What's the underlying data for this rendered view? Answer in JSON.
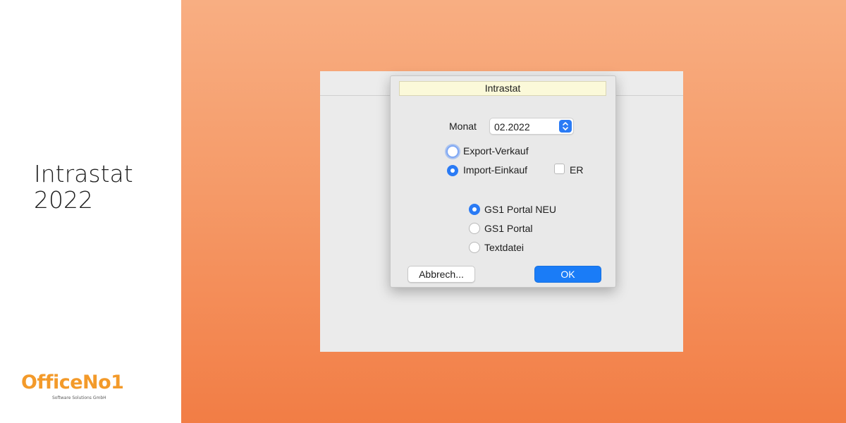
{
  "promo": {
    "title_line1": "Intrastat",
    "title_line2": "2022"
  },
  "logo": {
    "brand": "OfficeNo1",
    "tagline": "Software Solutions GmbH"
  },
  "dialog": {
    "title": "Intrastat",
    "month": {
      "label": "Monat",
      "value": "02.2022"
    },
    "direction_options": [
      {
        "label": "Export-Verkauf",
        "selected": false,
        "focused": true
      },
      {
        "label": "Import-Einkauf",
        "selected": true
      }
    ],
    "er_checkbox": {
      "label": "ER",
      "checked": false
    },
    "target_options": [
      {
        "label": "GS1 Portal NEU",
        "selected": true
      },
      {
        "label": "GS1 Portal",
        "selected": false
      },
      {
        "label": "Textdatei",
        "selected": false
      }
    ],
    "buttons": {
      "cancel": "Abbrech...",
      "ok": "OK"
    }
  },
  "colors": {
    "accent": "#2a7bf5",
    "logo_orange": "#f39a2a",
    "bg_top": "#f8ae82",
    "bg_bottom": "#f27d45",
    "title_bar": "#fbf9d9"
  },
  "icons": {
    "select_stepper": "chevron-up-down-icon"
  }
}
